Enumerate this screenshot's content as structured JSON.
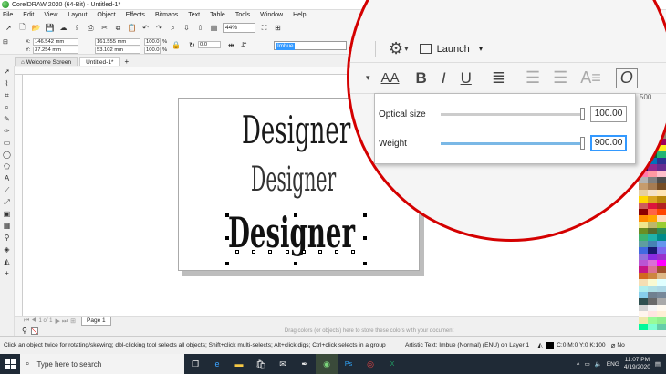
{
  "title": "CorelDRAW 2020 (64-Bit) - Untitled-1*",
  "menu": [
    "File",
    "Edit",
    "View",
    "Layout",
    "Object",
    "Effects",
    "Bitmaps",
    "Text",
    "Table",
    "Tools",
    "Window",
    "Help"
  ],
  "stdbar": {
    "zoom": "44%"
  },
  "propbar": {
    "x_label": "X:",
    "x_value": "146.542 mm",
    "y_label": "Y:",
    "y_value": "37.254 mm",
    "w_value": "161.555 mm",
    "h_value": "53.102 mm",
    "sx_value": "100.0",
    "sy_value": "100.0",
    "pct1": "%",
    "pct2": "%",
    "angle_value": "0.0",
    "font_name": "Imbue"
  },
  "tabs": {
    "welcome": "Welcome Screen",
    "doc": "Untitled-1*",
    "add": "+"
  },
  "canvas_texts": {
    "d1": "Designer",
    "d2": "Designer",
    "d3": "Designer"
  },
  "docnav": {
    "pager": "1 of 1",
    "page_tab": "Page 1"
  },
  "hint": "Drag colors (or objects) here to store these colors with your document",
  "status": {
    "left": "Click an object twice for rotating/skewing; dbl-clicking tool selects all objects; Shift+click multi-selects; Alt+click digs; Ctrl+click selects in a group",
    "mid": "Artistic Text: Imbue (Normal) (ENU) on Layer 1",
    "fill": "C:0 M:0 Y:0 K:100",
    "outline": "No"
  },
  "taskbar": {
    "search_placeholder": "Type here to search",
    "lang": "ENG",
    "time": "11:07 PM",
    "date": "4/19/2020"
  },
  "magnifier": {
    "launch_label": "Launch",
    "ruler_label": "500",
    "optical_label": "Optical size",
    "optical_value": "100.00",
    "optical_level": 1.0,
    "weight_label": "Weight",
    "weight_value": "900.00",
    "weight_level": 1.0
  },
  "colors": {
    "accent": "#d40000",
    "selection": "#3399ff"
  },
  "palette": [
    "#ffffff",
    "#000000",
    "#e6e6e6",
    "#cccccc",
    "#999999",
    "#666666",
    "#333333",
    "#00a0e9",
    "#e4007f",
    "#fff100",
    "#000000",
    "#00a0e9",
    "#e4007f",
    "#fff100",
    "#00a651",
    "#ed1c24",
    "#2e3192",
    "#f7941d",
    "#8dc63f",
    "#ee2a7b",
    "#00aeef",
    "#662d91",
    "#f9ed32",
    "#39b54a",
    "#d7df23",
    "#f15a24",
    "#c1272d",
    "#8c6239",
    "#603813",
    "#998675",
    "#c7b299",
    "#ec008c",
    "#9e005d",
    "#f26c4f",
    "#fbb040",
    "#fcee21",
    "#8cc63f",
    "#006837",
    "#22b573",
    "#29abe2",
    "#0071bc",
    "#2e3192",
    "#1b1464",
    "#93278f",
    "#662d91",
    "#ff7bac",
    "#ff9aa2",
    "#ffc0cb",
    "#b3b3b3",
    "#808080",
    "#4d4d4d",
    "#c69c6d",
    "#a67c52",
    "#754c24",
    "#e6cfa1",
    "#f4e2c9",
    "#ffe5b4",
    "#ffd700",
    "#daa520",
    "#b8860b",
    "#cd5c5c",
    "#dc143c",
    "#b22222",
    "#8b0000",
    "#ff6347",
    "#ff4500",
    "#ff8c00",
    "#ffa500",
    "#ffdab9",
    "#f0e68c",
    "#bdb76b",
    "#9acd32",
    "#6b8e23",
    "#556b2f",
    "#2e8b57",
    "#3cb371",
    "#20b2aa",
    "#008b8b",
    "#5f9ea0",
    "#4682b4",
    "#6495ed",
    "#4169e1",
    "#191970",
    "#7b68ee",
    "#9370db",
    "#8a2be2",
    "#9932cc",
    "#ba55d3",
    "#da70d6",
    "#ff00ff",
    "#c71585",
    "#db7093",
    "#a0522d",
    "#d2691e",
    "#cd853f",
    "#deb887",
    "#f5deb3",
    "#fafad2",
    "#e0ffff",
    "#afeeee",
    "#b0e0e6",
    "#add8e6",
    "#87ceeb",
    "#708090",
    "#778899",
    "#2f4f4f",
    "#696969",
    "#a9a9a9",
    "#d3d3d3",
    "#f5f5f5",
    "#fffaf0",
    "#fff5ee",
    "#ffe4e1",
    "#ffefd5",
    "#eee8aa",
    "#98fb98",
    "#90ee90",
    "#00fa9a",
    "#7fffd4",
    "#66cdaa",
    "#40e0d0",
    "#48d1cc",
    "#00ced1",
    "#1e90ff",
    "#00bfff",
    "#87cefa",
    "#b0c4de",
    "#e6e6fa",
    "#d8bfd8",
    "#dda0dd",
    "#ee82ee",
    "#ff69b4",
    "#ff1493",
    "#f08080",
    "#fa8072",
    "#e9967a",
    "#ffa07a",
    "#f4a460",
    "#d2b48c",
    "#bc8f8f",
    "#800000",
    "#808000",
    "#008000",
    "#008080",
    "#000080",
    "#800080"
  ]
}
